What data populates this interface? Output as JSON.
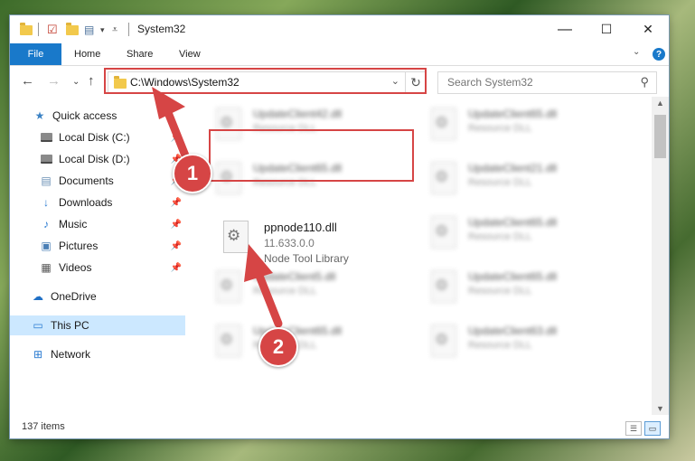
{
  "window": {
    "title": "System32",
    "controls": {
      "minimize": "—",
      "maximize": "☐",
      "close": "✕"
    }
  },
  "ribbon": {
    "file": "File",
    "tabs": [
      "Home",
      "Share",
      "View"
    ],
    "help": "?"
  },
  "navbar": {
    "address": "C:\\Windows\\System32",
    "search_placeholder": "Search System32"
  },
  "sidebar": {
    "items": [
      {
        "label": "Quick access",
        "icon": "star-icon"
      },
      {
        "label": "Local Disk (C:)",
        "icon": "disk-icon"
      },
      {
        "label": "Local Disk (D:)",
        "icon": "disk-icon"
      },
      {
        "label": "Documents",
        "icon": "documents-icon"
      },
      {
        "label": "Downloads",
        "icon": "downloads-icon"
      },
      {
        "label": "Music",
        "icon": "music-icon"
      },
      {
        "label": "Pictures",
        "icon": "pictures-icon"
      },
      {
        "label": "Videos",
        "icon": "videos-icon"
      },
      {
        "label": "OneDrive",
        "icon": "cloud-icon"
      },
      {
        "label": "This PC",
        "icon": "computer-icon"
      },
      {
        "label": "Network",
        "icon": "network-icon"
      }
    ]
  },
  "files": {
    "left": [
      {
        "name": "UpdateClient42.dll",
        "type": "Resource DLL"
      },
      {
        "name": "UpdateClient65.dll",
        "type": "Resource DLL"
      },
      {
        "name": "ppnode110.dll",
        "version": "11.633.0.0",
        "description": "Node Tool Library"
      },
      {
        "name": "UpdateClient5.dll",
        "type": "Resource DLL"
      },
      {
        "name": "UpdateClient65.dll",
        "type": "Resource DLL"
      }
    ],
    "right": [
      {
        "name": "UpdateClient65.dll",
        "type": "Resource DLL"
      },
      {
        "name": "UpdateClient21.dll",
        "type": "Resource DLL"
      },
      {
        "name": "UpdateClient65.dll",
        "type": "Resource DLL"
      },
      {
        "name": "UpdateClient65.dll",
        "type": "Resource DLL"
      },
      {
        "name": "UpdateClient63.dll",
        "type": "Resource DLL"
      }
    ]
  },
  "status": {
    "count": "137 items"
  },
  "annotations": {
    "step1": "1",
    "step2": "2",
    "color": "#d64545"
  }
}
